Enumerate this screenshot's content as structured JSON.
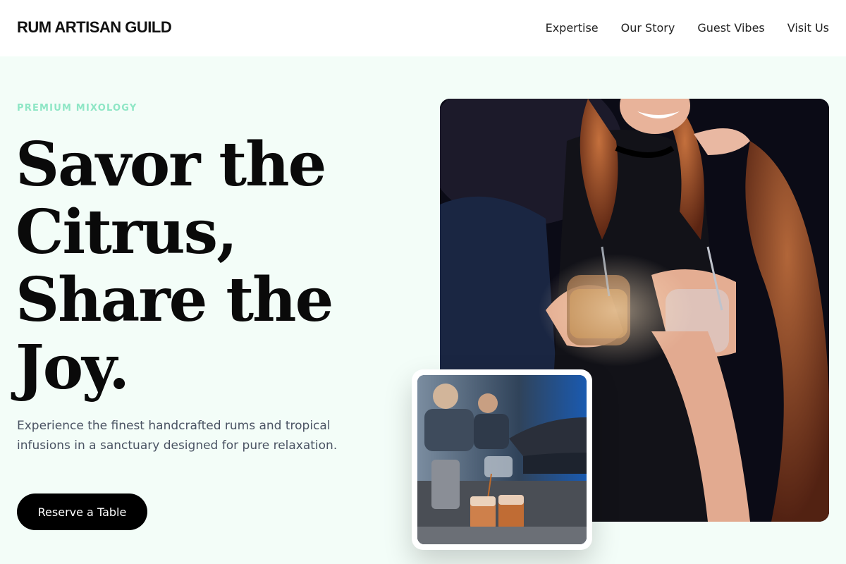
{
  "header": {
    "brand": "RUM ARTISAN GUILD",
    "nav": [
      "Expertise",
      "Our Story",
      "Guest Vibes",
      "Visit Us"
    ]
  },
  "hero": {
    "eyebrow": "PREMIUM MIXOLOGY",
    "headline_lines": [
      "Savor the",
      "Citrus,",
      "Share the",
      "Joy."
    ],
    "lead": "Experience the finest handcrafted rums and tropical infusions in a sanctuary designed for pure relaxation.",
    "cta_label": "Reserve a Table"
  },
  "colors": {
    "page_background": "#f3fdf8",
    "eyebrow_accent": "#8ee6c5",
    "cta_background": "#000000",
    "body_text": "#4a5363"
  }
}
